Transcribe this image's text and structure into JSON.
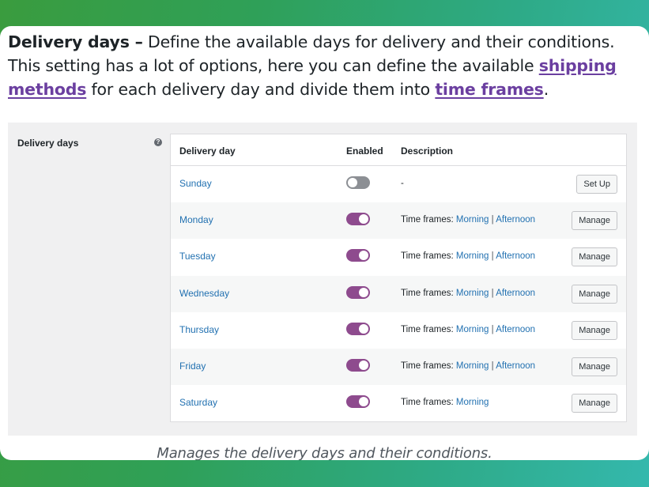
{
  "intro": {
    "bold": "Delivery days –",
    "text1": " Define the available days for delivery and their conditions. This setting has a lot of options, here you can define the available ",
    "link1": "shipping methods",
    "text2": " for each delivery day and divide them into ",
    "link2": "time frames",
    "text3": "."
  },
  "settings": {
    "label": "Delivery days",
    "help": "?",
    "columns": {
      "day": "Delivery day",
      "enabled": "Enabled",
      "description": "Description"
    },
    "rows": [
      {
        "day": "Sunday",
        "enabled": false,
        "description": "-",
        "action": "Set Up"
      },
      {
        "day": "Monday",
        "enabled": true,
        "tf_label": "Time frames:",
        "tf1": "Morning",
        "sep": "|",
        "tf2": "Afternoon",
        "action": "Manage"
      },
      {
        "day": "Tuesday",
        "enabled": true,
        "tf_label": "Time frames:",
        "tf1": "Morning",
        "sep": "|",
        "tf2": "Afternoon",
        "action": "Manage"
      },
      {
        "day": "Wednesday",
        "enabled": true,
        "tf_label": "Time frames:",
        "tf1": "Morning",
        "sep": "|",
        "tf2": "Afternoon",
        "action": "Manage"
      },
      {
        "day": "Thursday",
        "enabled": true,
        "tf_label": "Time frames:",
        "tf1": "Morning",
        "sep": "|",
        "tf2": "Afternoon",
        "action": "Manage"
      },
      {
        "day": "Friday",
        "enabled": true,
        "tf_label": "Time frames:",
        "tf1": "Morning",
        "sep": "|",
        "tf2": "Afternoon",
        "action": "Manage"
      },
      {
        "day": "Saturday",
        "enabled": true,
        "tf_label": "Time frames:",
        "tf1": "Morning",
        "action": "Manage"
      }
    ]
  },
  "caption": "Manages the delivery days and their conditions.",
  "colors": {
    "toggle_on": "#8e4b8e",
    "toggle_off": "#8c8f94",
    "link": "#2271b1",
    "intro_link": "#6b3fa0"
  }
}
